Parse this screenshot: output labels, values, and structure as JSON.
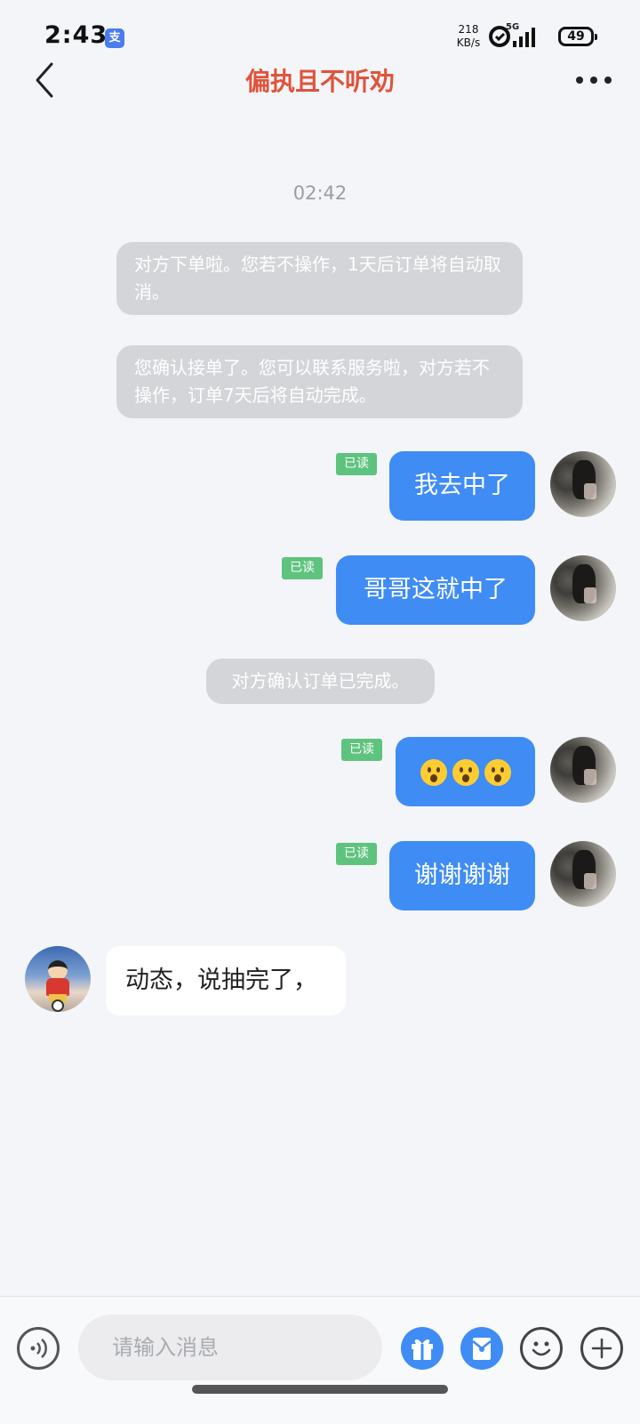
{
  "status_bar": {
    "time": "2:43",
    "app_badge": "支",
    "net_speed_value": "218",
    "net_speed_unit": "KB/s",
    "network_type": "5G",
    "battery": "49"
  },
  "header": {
    "title": "偏执且不听劝"
  },
  "chat": {
    "timestamp": "02:42",
    "system_messages": [
      "对方下单啦。您若不操作，1天后订单将自动取消。",
      "您确认接单了。您可以联系服务啦，对方若不操作，订单7天后将自动完成。",
      "对方确认订单已完成。"
    ],
    "outgoing": [
      {
        "text": "我去中了",
        "status": "已读"
      },
      {
        "text": "哥哥这就中了",
        "status": "已读"
      },
      {
        "text": "",
        "emoji_count": 3,
        "emoji_icon": "hushed-face-icon",
        "status": "已读"
      },
      {
        "text": "谢谢谢谢",
        "status": "已读"
      }
    ],
    "incoming": [
      {
        "text": "动态，说抽完了，"
      }
    ]
  },
  "input_bar": {
    "placeholder": "请输入消息",
    "icons": [
      "voice-icon",
      "gift-icon",
      "red-packet-icon",
      "emoji-icon",
      "plus-icon"
    ]
  },
  "colors": {
    "title": "#e0533b",
    "outgoing_bubble": "#3f8cf5",
    "read_badge": "#5ec37e",
    "system_bubble": "#d3d5d8",
    "background": "#f3f5f8"
  }
}
